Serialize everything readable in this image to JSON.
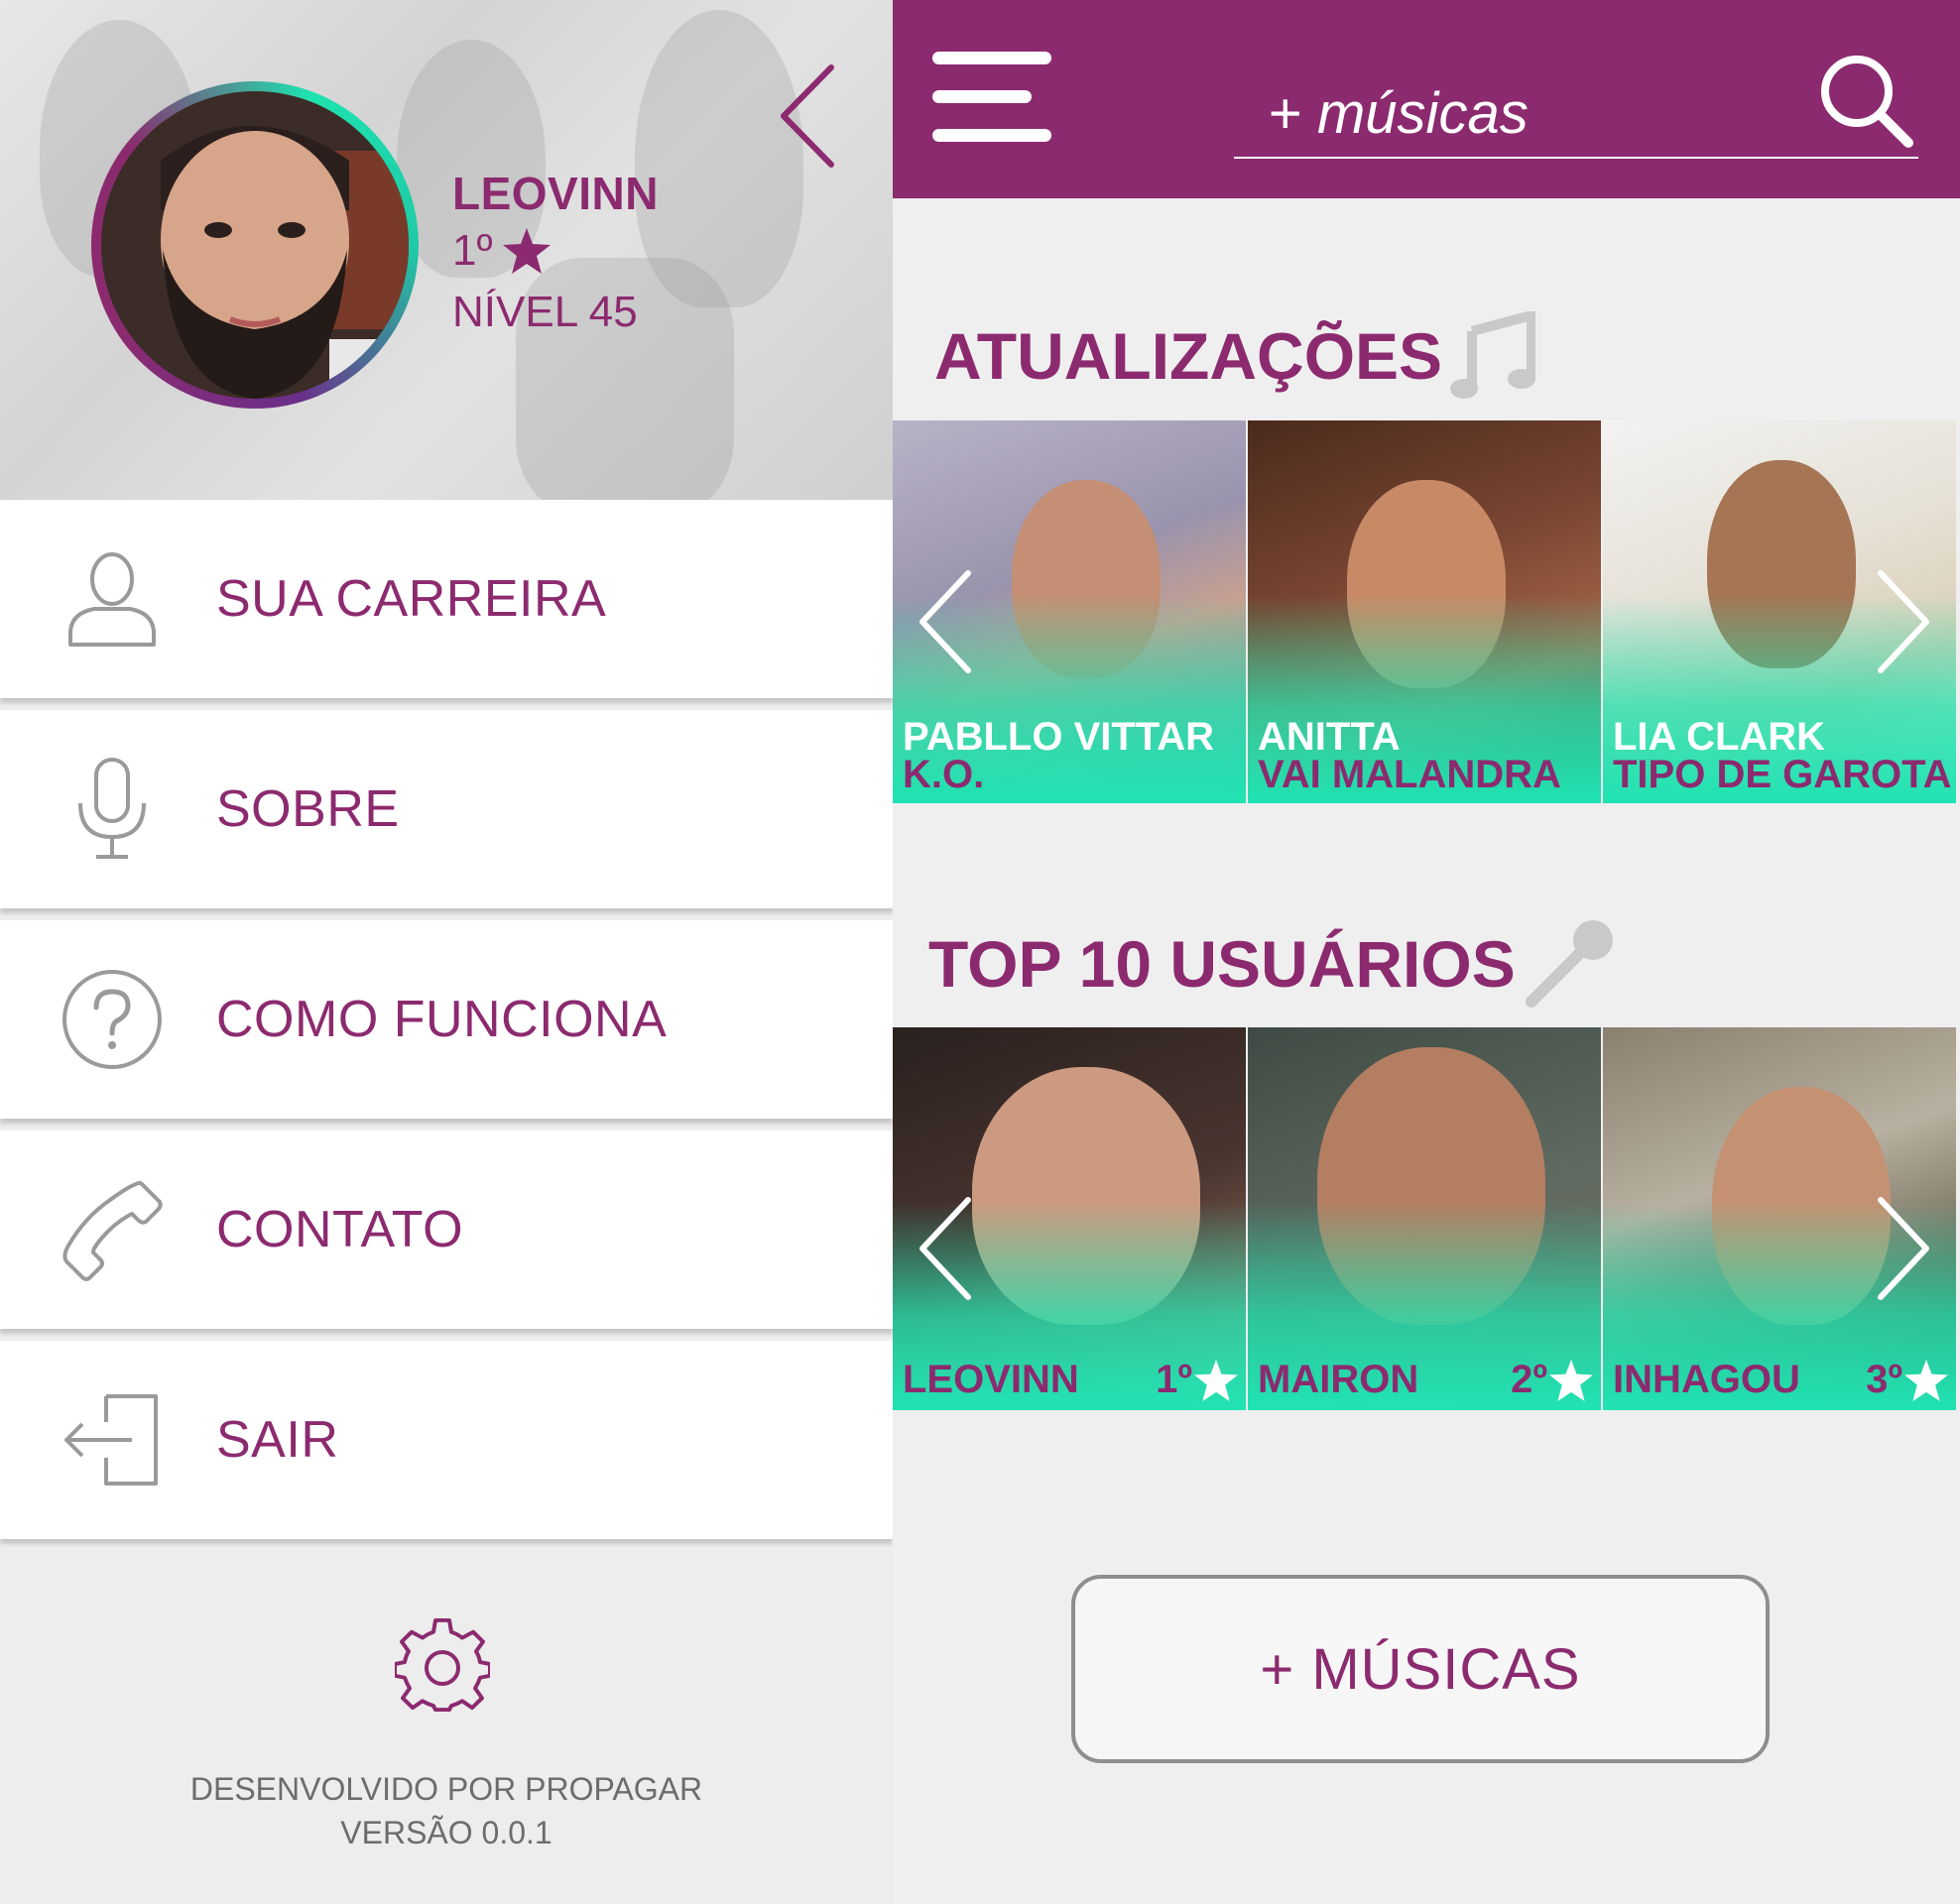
{
  "profile": {
    "name": "LEOVINN",
    "rank": "1º",
    "level": "NÍVEL 45"
  },
  "menu": {
    "items": [
      {
        "label": "SUA CARREIRA",
        "icon": "user-icon"
      },
      {
        "label": "SOBRE",
        "icon": "microphone-icon"
      },
      {
        "label": "COMO FUNCIONA",
        "icon": "question-icon"
      },
      {
        "label": "CONTATO",
        "icon": "phone-icon"
      },
      {
        "label": "SAIR",
        "icon": "logout-icon"
      }
    ]
  },
  "footer": {
    "developer": "DESENVOLVIDO POR PROPAGAR",
    "version": "VERSÃO 0.0.1"
  },
  "search": {
    "placeholder": "+ músicas"
  },
  "updates": {
    "title": "ATUALIZAÇÕES",
    "icon": "music-note-icon",
    "items": [
      {
        "artist": "PABLLO VITTAR",
        "song": "K.O."
      },
      {
        "artist": "ANITTA",
        "song": "VAI MALANDRA"
      },
      {
        "artist": "LIA CLARK",
        "song": "TIPO DE GAROTA"
      }
    ]
  },
  "top_users": {
    "title": "TOP 10 USUÁRIOS",
    "icon": "microphone-icon",
    "items": [
      {
        "name": "LEOVINN",
        "rank": "1º"
      },
      {
        "name": "MAIRON",
        "rank": "2º"
      },
      {
        "name": "INHAGOU",
        "rank": "3º"
      }
    ]
  },
  "more_button": {
    "label": "+ MÚSICAS"
  },
  "colors": {
    "brand": "#8c2a6f",
    "accent": "#1ee3b0",
    "background": "#efefef"
  }
}
